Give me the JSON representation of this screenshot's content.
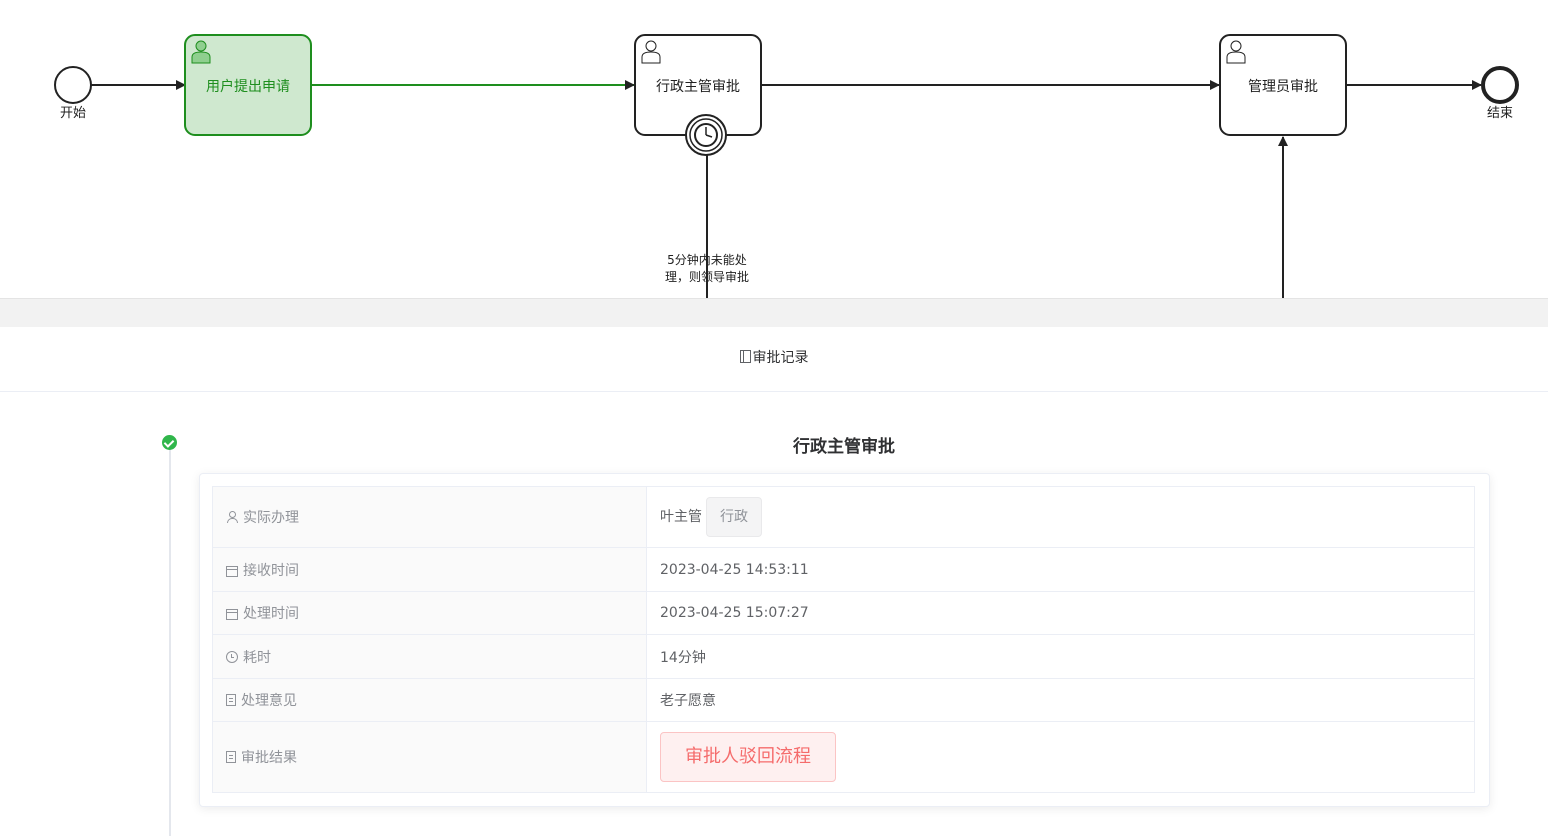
{
  "diagram": {
    "start_label": "开始",
    "end_label": "结束",
    "tasks": [
      {
        "label": "用户提出申请",
        "status": "completed"
      },
      {
        "label": "行政主管审批",
        "status": "pending"
      },
      {
        "label": "管理员审批",
        "status": "pending"
      }
    ],
    "timer_flow_label_line1": "5分钟内未能处",
    "timer_flow_label_line2": "理，则领导审批",
    "colors": {
      "completed_fill": "#cfe8cf",
      "completed_stroke": "#1e8e1e",
      "default_stroke": "#222222"
    }
  },
  "records": {
    "header": "审批记录",
    "entry": {
      "title": "行政主管审批",
      "status_icon": "check-circle-icon",
      "status_color": "#30b64b",
      "rows": [
        {
          "label": "实际办理",
          "icon": "user-icon",
          "value": "叶主管",
          "tag": "行政"
        },
        {
          "label": "接收时间",
          "icon": "calendar-icon",
          "value": "2023-04-25 14:53:11"
        },
        {
          "label": "处理时间",
          "icon": "calendar-icon",
          "value": "2023-04-25 15:07:27"
        },
        {
          "label": "耗时",
          "icon": "clock-icon",
          "value": "14分钟"
        },
        {
          "label": "处理意见",
          "icon": "document-icon",
          "value": "老子愿意"
        },
        {
          "label": "审批结果",
          "icon": "document-icon",
          "value": "审批人驳回流程"
        }
      ]
    }
  }
}
